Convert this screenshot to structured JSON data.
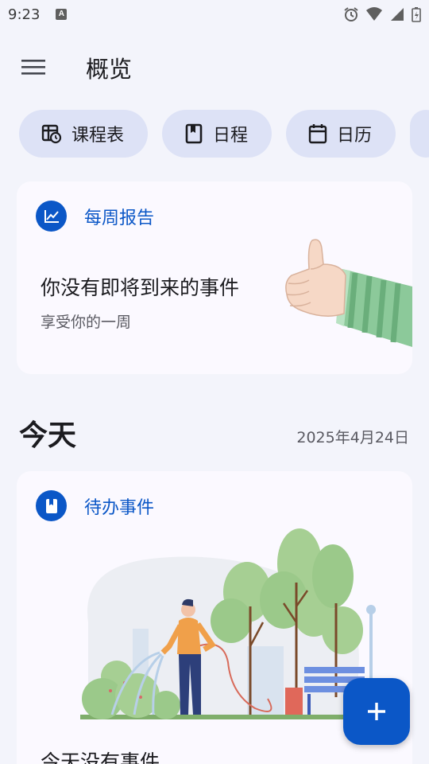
{
  "status_bar": {
    "time": "9:23",
    "badge": "A"
  },
  "app_bar": {
    "title": "概览"
  },
  "chips": [
    {
      "label": "课程表",
      "icon": "timetable-icon"
    },
    {
      "label": "日程",
      "icon": "bookmark-book-icon"
    },
    {
      "label": "日历",
      "icon": "calendar-icon"
    }
  ],
  "weekly_report": {
    "title": "每周报告",
    "icon": "trending-chart-icon",
    "message": "你没有即将到来的事件",
    "subtitle": "享受你的一周"
  },
  "today": {
    "title": "今天",
    "date": "2025年4月24日"
  },
  "todo": {
    "title": "待办事件",
    "icon": "bookmark-icon",
    "empty_message": "今天没有事件"
  },
  "fab": {
    "icon": "plus-icon"
  },
  "colors": {
    "accent": "#0b57c7",
    "chip_bg": "#dde2f6",
    "card_bg": "#fbf9ff",
    "page_bg": "#f3f4fb"
  }
}
